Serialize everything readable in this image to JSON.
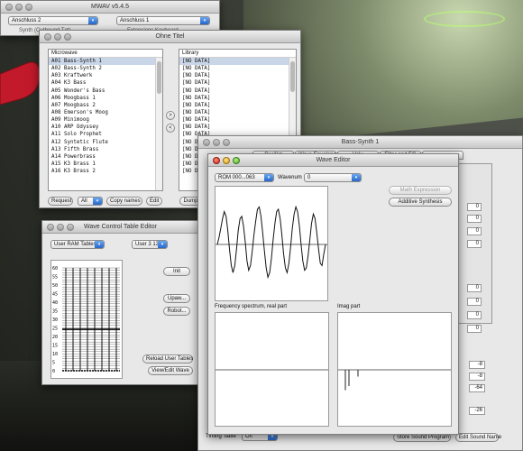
{
  "mwav": {
    "title": "MWAV v5.4.5",
    "port_out": "Anschluss 2",
    "port_in": "Anschluss 1",
    "sub_left": "Synth (Outbound Tgt)",
    "sub_right": "Extensions Keyboard"
  },
  "ohne_titel": {
    "title": "Ohne Titel",
    "microwave_header": "Microwave",
    "library_header": "Library",
    "microwave_items": [
      "A01 Bass-Synth 1",
      "A02 Bass-Synth 2",
      "A03 Kraftwerk",
      "A04 K3 Bass",
      "A05 Wonder's Bass",
      "A06 Moogbass 1",
      "A07 Moogbass 2",
      "A08 Emerson's Moog",
      "A09 Minimoog",
      "A10 ARP Odyssey",
      "A11 Solo Prophet",
      "A12 Syntetic Flute",
      "A13 Fifth Brass",
      "A14 Powerbrass",
      "A15 K3 Brass 1",
      "A16 K3 Brass 2"
    ],
    "library_items": [
      "[NO DATA]",
      "[NO DATA]",
      "[NO DATA]",
      "[NO DATA]",
      "[NO DATA]",
      "[NO DATA]",
      "[NO DATA]",
      "[NO DATA]",
      "[NO DATA]",
      "[NO DATA]",
      "[NO DATA]",
      "[NO DATA]",
      "[NO DATA]",
      "[NO DATA]",
      "[NO DATA]",
      "[NO DATA]"
    ],
    "move_right": ">",
    "move_left": "<",
    "request": "Request",
    "request_scope": "All",
    "copy_names": "Copy names",
    "edit": "Edit",
    "dump": "Dump..."
  },
  "wave_control": {
    "title": "Wave Control Table Editor",
    "table_type": "User RAM Tables",
    "table_select": "User 3 135",
    "y_ticks": [
      "60",
      "55",
      "50",
      "45",
      "40",
      "35",
      "30",
      "25",
      "20",
      "15",
      "10",
      "5",
      "0"
    ],
    "init": "Init",
    "upward": "Upaw...",
    "robot": "Robot...",
    "reload": "Reload User Tables",
    "view_edit": "View/Edit Wave"
  },
  "bass_synth": {
    "title": "Bass-Synth 1",
    "tabs": [
      "Oscillat",
      "Wave Envelope",
      "Volu",
      "Filter and EG",
      "..."
    ],
    "field_values": [
      "0",
      "0",
      "0",
      "0",
      "0",
      "0",
      "0",
      "0"
    ],
    "bottom_values": [
      "-8",
      "-8",
      "-64",
      "-26"
    ],
    "timing_label": "Timing Table",
    "timing_value": "Off",
    "store": "Store Sound Program",
    "edit_name": "Edit Sound Name"
  },
  "wave_editor": {
    "title": "Wave Editor",
    "rom": "ROM 000...063",
    "wavenum_label": "Wavenum",
    "wavenum": "0",
    "math_expression": "Math Expression",
    "additive": "Additive Synthesis",
    "freq_label": "Frequency spectrum, real part",
    "imag_label": "Imag part",
    "wave_samples": [
      0.0,
      0.15,
      0.35,
      0.55,
      0.7,
      0.6,
      0.3,
      -0.1,
      -0.45,
      -0.6,
      -0.45,
      -0.1,
      0.3,
      0.55,
      0.6,
      0.4,
      0.05,
      -0.35,
      -0.55,
      -0.45,
      -0.15,
      0.2,
      0.5,
      0.75,
      0.8,
      0.6,
      0.25,
      -0.15,
      -0.5,
      -0.7,
      -0.6,
      -0.3,
      0.1,
      0.45,
      0.7,
      0.75,
      0.55,
      0.2,
      -0.2,
      -0.5,
      -0.6,
      -0.4,
      -0.05,
      0.35,
      0.65,
      0.8,
      0.7,
      0.4,
      0.0,
      -0.35,
      -0.55,
      -0.5,
      -0.25,
      0.1,
      0.45,
      0.65,
      0.55,
      0.25,
      -0.1,
      -0.4,
      -0.45,
      -0.2,
      0.0
    ],
    "imag_bars": [
      -0.75,
      -0.6,
      -0.25
    ]
  },
  "colors": {
    "select_blue": "#2767c9",
    "highlight": "#c9d6e8"
  }
}
